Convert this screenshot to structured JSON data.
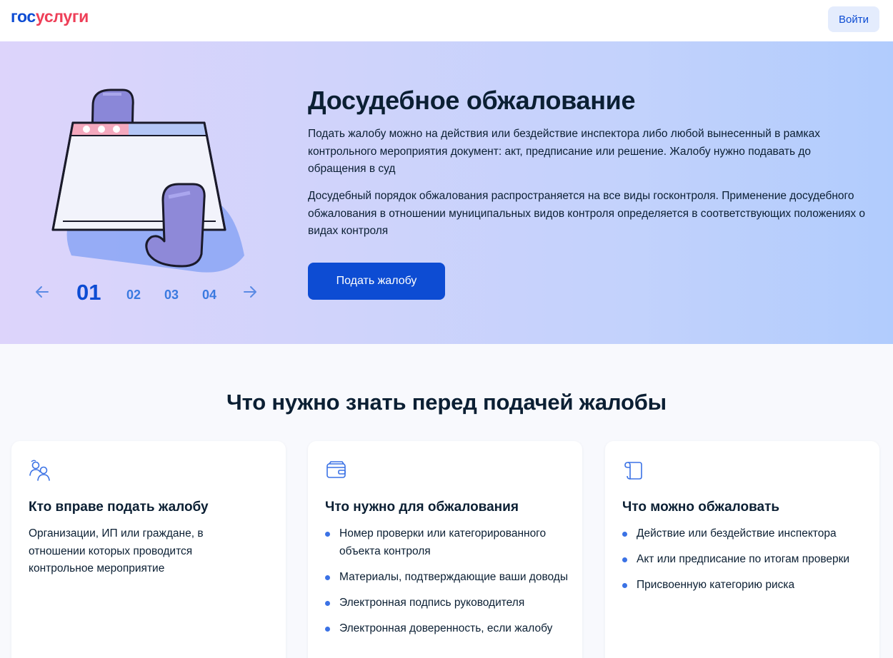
{
  "header": {
    "logo_part1": "гос",
    "logo_part2": "услуги",
    "login_label": "Войти"
  },
  "hero": {
    "title": "Досудебное обжалование",
    "paragraph1": "Подать жалобу можно на действия или бездействие инспектора либо любой вынесенный в рамках контрольного мероприятия документ: акт, предписание или решение. Жалобу нужно подавать до обращения в суд",
    "paragraph2": "Досудебный порядок обжалования распространяется на все виды госконтроля. Применение досудебного обжалования в отношении муниципальных видов контроля определяется в соответствующих положениях о видах контроля",
    "cta_label": "Подать жалобу",
    "pager": {
      "prev_icon": "arrow-left-icon",
      "next_icon": "arrow-right-icon",
      "pages": [
        "01",
        "02",
        "03",
        "04"
      ],
      "active": "01"
    }
  },
  "section": {
    "title": "Что нужно знать перед подачей жалобы",
    "cards": [
      {
        "icon": "people-icon",
        "title": "Кто вправе подать жалобу",
        "text": "Организации, ИП или граждане, в отношении которых проводится контрольное мероприятие"
      },
      {
        "icon": "wallet-icon",
        "title": "Что нужно для обжалования",
        "items": [
          "Номер проверки или категорированного объекта контроля",
          "Материалы, подтверждающие ваши доводы",
          "Электронная подпись руководителя",
          "Электронная доверенность, если жалобу"
        ]
      },
      {
        "icon": "scroll-icon",
        "title": "Что можно обжаловать",
        "items": [
          "Действие или бездействие инспектора",
          "Акт или предписание по итогам проверки",
          "Присвоенную категорию риска"
        ]
      }
    ]
  },
  "colors": {
    "brand_blue": "#0d4cd3",
    "brand_red": "#ee3f58",
    "text": "#0b1f33"
  }
}
